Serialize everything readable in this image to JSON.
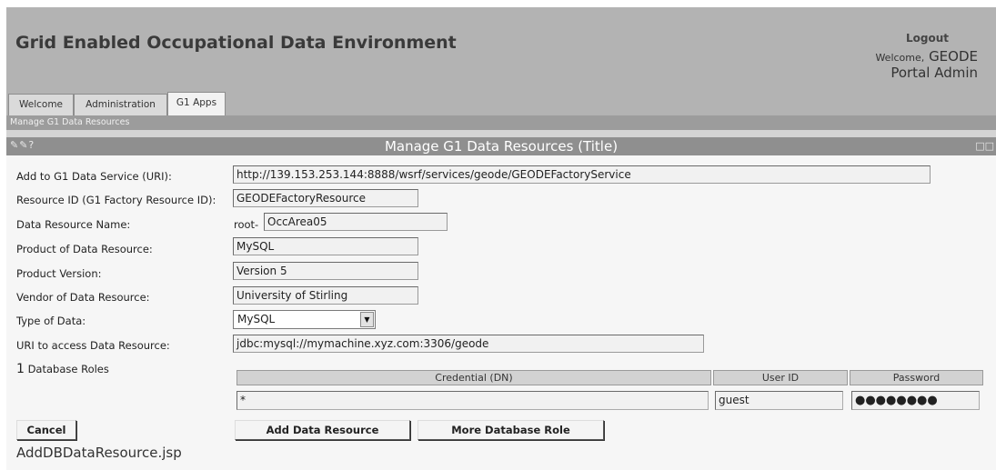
{
  "header": {
    "title": "Grid Enabled Occupational Data Environment",
    "logout_label": "Logout",
    "welcome_prefix": "Welcome,",
    "welcome_name_line1": "GEODE",
    "welcome_name_line2": "Portal Admin"
  },
  "tabs": [
    {
      "label": "Welcome",
      "active": false
    },
    {
      "label": "Administration",
      "active": false
    },
    {
      "label": "G1 Apps",
      "active": true
    }
  ],
  "breadcrumb": "Manage G1 Data Resources",
  "portlet": {
    "tools": "✎✎?",
    "title": "Manage G1 Data Resources (Title)",
    "window_controls": "□□"
  },
  "form": {
    "service_uri": {
      "label": "Add to G1 Data Service (URI):",
      "value": "http://139.153.253.144:8888/wsrf/services/geode/GEODEFactoryService"
    },
    "resource_id": {
      "label": "Resource ID (G1 Factory Resource ID):",
      "value": "GEODEFactoryResource"
    },
    "resource_name": {
      "label": "Data Resource Name:",
      "prefix": "root-",
      "value": "OccArea05"
    },
    "product": {
      "label": "Product of Data Resource:",
      "value": "MySQL"
    },
    "version": {
      "label": "Product Version:",
      "value": "Version 5"
    },
    "vendor": {
      "label": "Vendor of Data Resource:",
      "value": "University of Stirling"
    },
    "data_type": {
      "label": "Type of Data:",
      "value": "MySQL"
    },
    "access_uri": {
      "label": "URI to access Data Resource:",
      "value": "jdbc:mysql://mymachine.xyz.com:3306/geode"
    },
    "roles": {
      "count": "1",
      "label": "Database Roles",
      "columns": [
        "Credential (DN)",
        "User ID",
        "Password"
      ],
      "row": {
        "credential": "*",
        "user_id": "guest",
        "password": "●●●●●●●●"
      }
    }
  },
  "buttons": {
    "cancel": "Cancel",
    "add": "Add Data Resource",
    "more": "More Database Role"
  },
  "footer_file": "AddDBDataResource.jsp"
}
